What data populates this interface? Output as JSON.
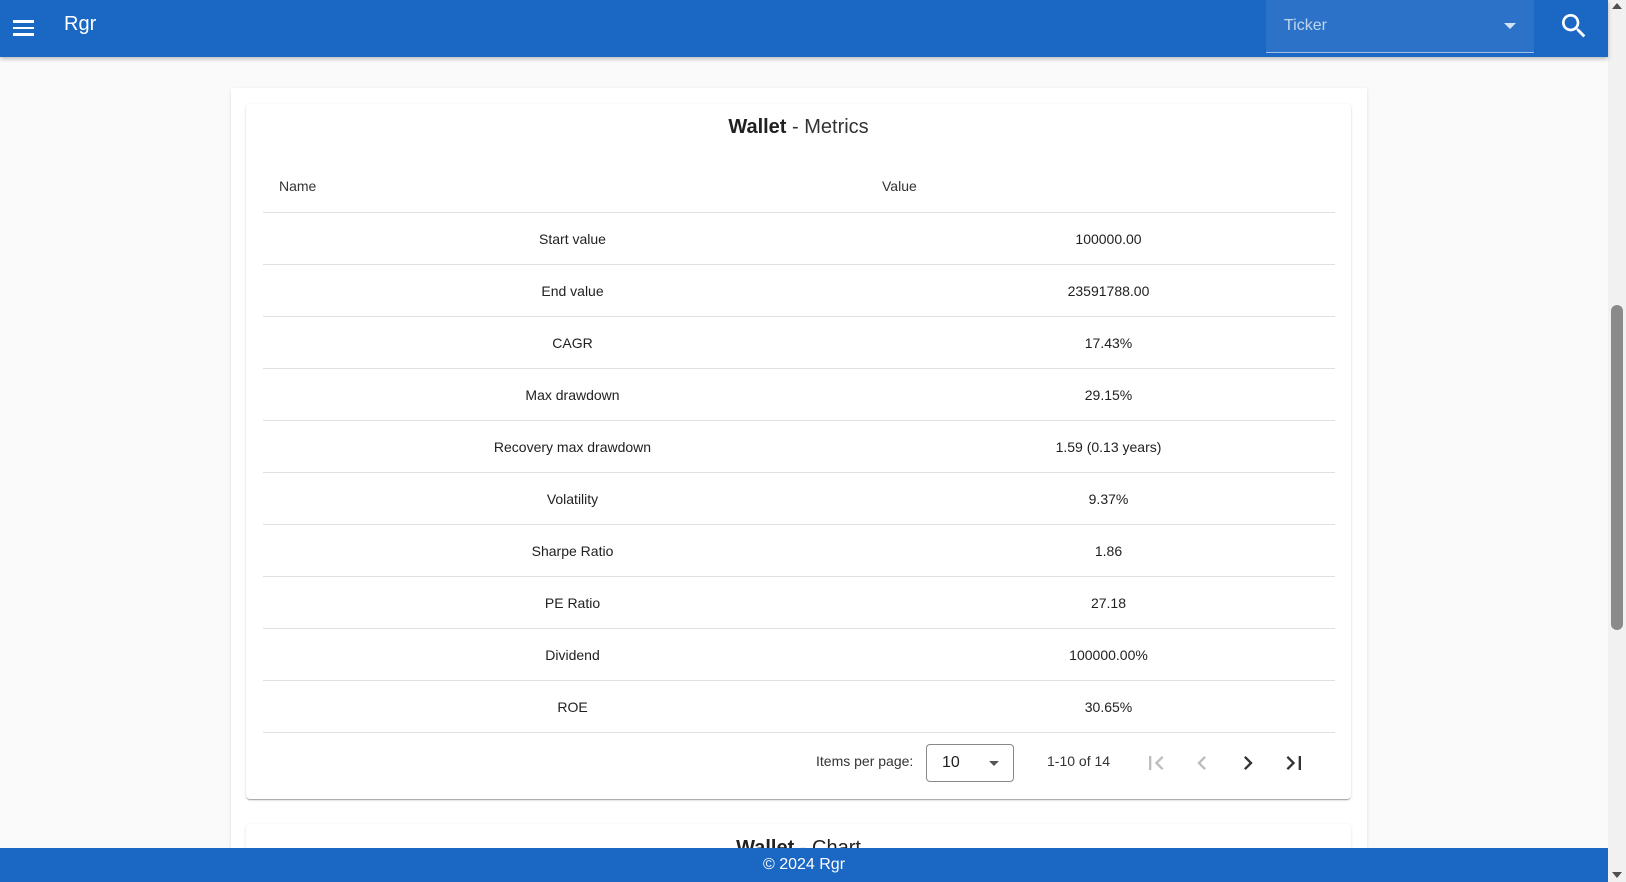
{
  "toolbar": {
    "brand": "Rgr",
    "ticker_placeholder": "Ticker",
    "menu_icon": "menu-icon",
    "search_icon": "search-icon",
    "color": "#1a67c4"
  },
  "metrics_card": {
    "title_bold": "Wallet",
    "title_rest": " - Metrics",
    "columns": {
      "name": "Name",
      "value": "Value"
    },
    "rows": [
      {
        "name": "Start value",
        "value": "100000.00"
      },
      {
        "name": "End value",
        "value": "23591788.00"
      },
      {
        "name": "CAGR",
        "value": "17.43%"
      },
      {
        "name": "Max drawdown",
        "value": "29.15%"
      },
      {
        "name": "Recovery max drawdown",
        "value": "1.59 (0.13 years)"
      },
      {
        "name": "Volatility",
        "value": "9.37%"
      },
      {
        "name": "Sharpe Ratio",
        "value": "1.86"
      },
      {
        "name": "PE Ratio",
        "value": "27.18"
      },
      {
        "name": "Dividend",
        "value": "100000.00%"
      },
      {
        "name": "ROE",
        "value": "30.65%"
      }
    ],
    "paginator": {
      "items_per_page_label": "Items per page:",
      "items_per_page_value": "10",
      "range_label": "1-10 of 14"
    }
  },
  "chart_card": {
    "title_bold": "Wallet",
    "title_rest": " - Chart"
  },
  "footer": {
    "text": "© 2024 Rgr"
  }
}
